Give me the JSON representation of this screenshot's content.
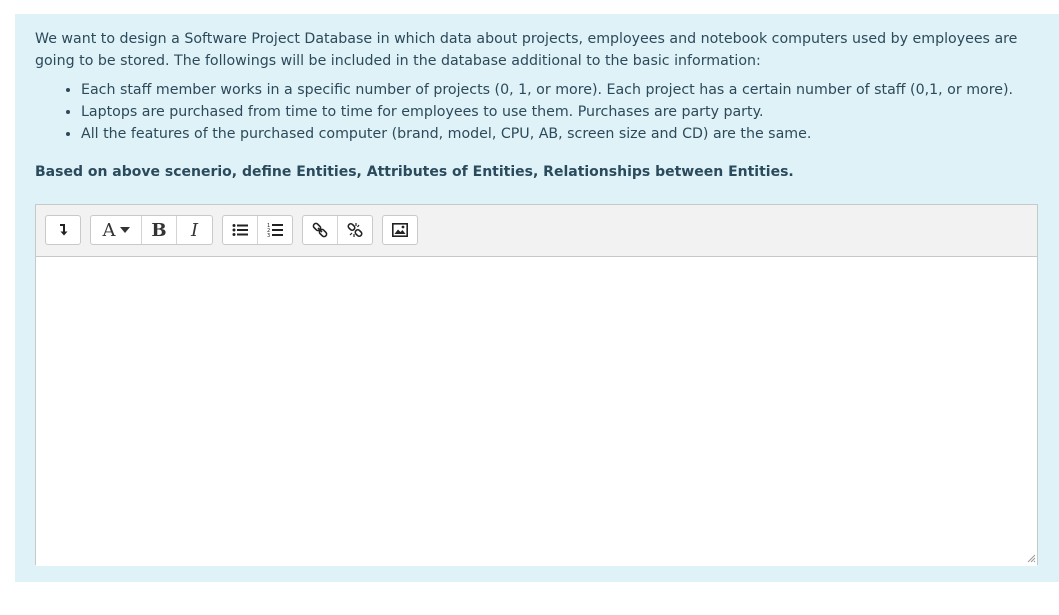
{
  "question": {
    "intro": "We want to design a Software Project Database in which data about projects, employees and  notebook computers used by employees are going to be stored. The followings will be included in the database additional to the basic information:",
    "bullets": [
      "Each staff member works in a specific number of projects (0, 1, or more). Each project has a certain number of staff (0,1, or more).",
      "Laptops are purchased from time to time for employees to use them. Purchases are party party.",
      "All the features of the purchased computer (brand, model, CPU, AB, screen size and CD) are the same."
    ],
    "prompt": "Based on above scenerio, define Entities, Attributes of Entities, Relationships between Entities."
  },
  "toolbar": {
    "toggle_icon": "arrow-down-icon",
    "font_label": "A",
    "bold_label": "B",
    "italic_label": "I",
    "unordered_list_icon": "unordered-list-icon",
    "ordered_list_icon": "ordered-list-icon",
    "link_icon": "link-icon",
    "unlink_icon": "unlink-icon",
    "image_icon": "image-icon"
  },
  "editor": {
    "value": ""
  },
  "colors": {
    "panel_bg": "#def2f8",
    "text": "#2d4a5a",
    "toolbar_bg": "#f2f2f2",
    "border": "#c6c9cb"
  }
}
